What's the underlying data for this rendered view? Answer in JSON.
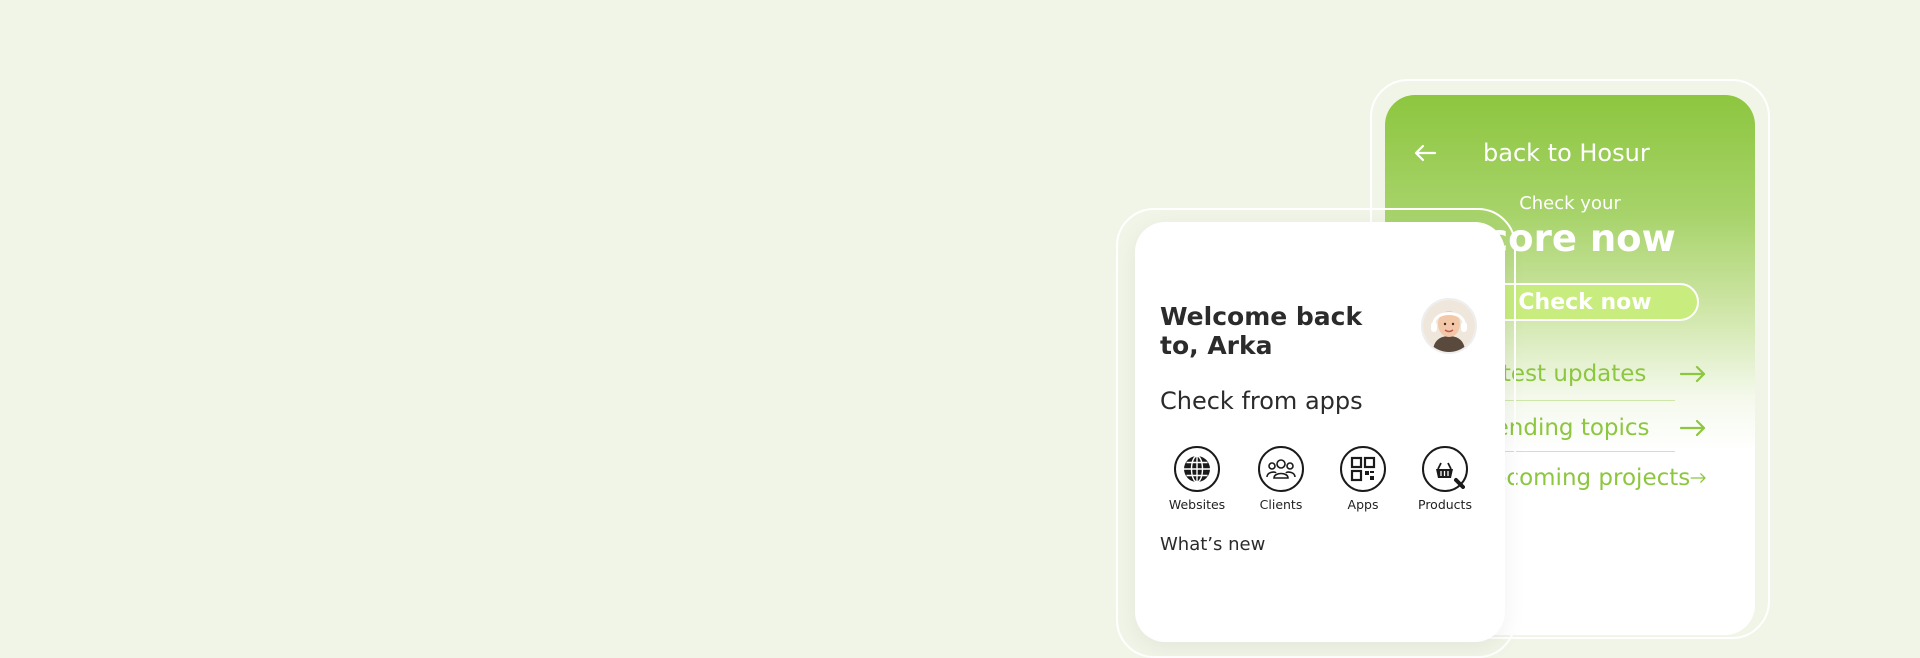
{
  "colors": {
    "background": "#f1f5e8",
    "accent_green": "#8dc63f",
    "light_green": "#c8ec7e",
    "text_dark": "#2b2b2b"
  },
  "back_phone": {
    "back_arrow_icon": "arrow-left-icon",
    "title": "back to Hosur",
    "subtitle": "Check your",
    "headline": "score now",
    "cta_label": "Check now",
    "links": [
      {
        "label": "Latest updates",
        "icon": "arrow-right-icon"
      },
      {
        "label": "Trending topics",
        "icon": "arrow-right-icon"
      },
      {
        "label": "Upcoming projects",
        "icon": "arrow-right-icon"
      }
    ]
  },
  "front_phone": {
    "welcome": "Welcome back to, Arka",
    "avatar_icon": "user-avatar",
    "section_title": "Check from apps",
    "apps": [
      {
        "label": "Websites",
        "icon": "globe-icon"
      },
      {
        "label": "Clients",
        "icon": "people-icon"
      },
      {
        "label": "Apps",
        "icon": "grid-icon"
      },
      {
        "label": "Products",
        "icon": "basket-search-icon"
      }
    ],
    "whats_new": "What’s new"
  }
}
